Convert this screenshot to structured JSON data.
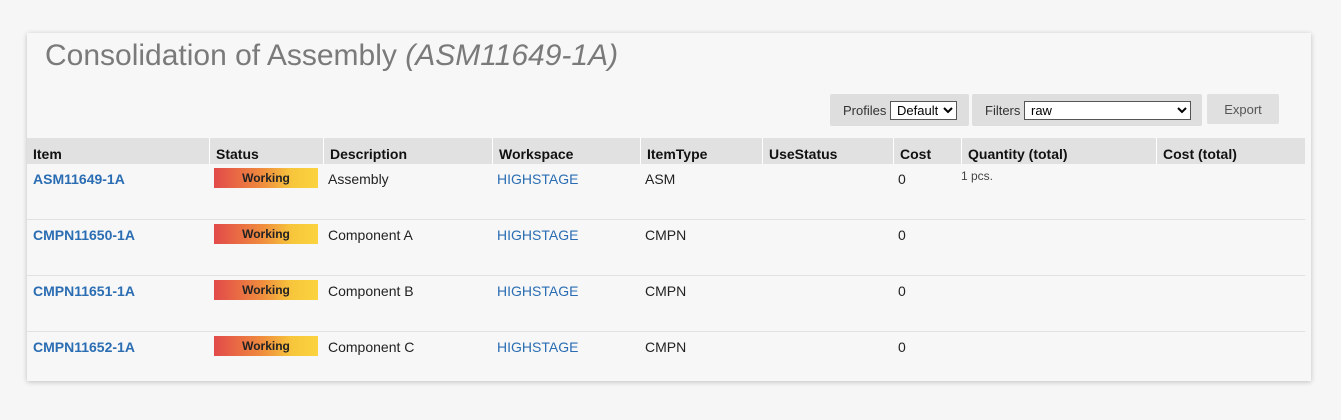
{
  "page": {
    "title_main": "Consolidation of Assembly",
    "title_code": "(ASM11649-1A)"
  },
  "toolbar": {
    "profiles_label": "Profiles",
    "profiles_value": "Default",
    "filters_label": "Filters",
    "filters_value": "raw",
    "export_label": "Export"
  },
  "table": {
    "columns": [
      "Item",
      "Status",
      "Description",
      "Workspace",
      "ItemType",
      "UseStatus",
      "Cost",
      "Quantity (total)",
      "Cost (total)"
    ],
    "rows": [
      {
        "item": "ASM11649-1A",
        "status": "Working",
        "description": "Assembly",
        "workspace": "HIGHSTAGE",
        "itemtype": "ASM",
        "usestatus": "",
        "cost": "0",
        "quantity_total": "1 pcs.",
        "cost_total": ""
      },
      {
        "item": "CMPN11650-1A",
        "status": "Working",
        "description": "Component A",
        "workspace": "HIGHSTAGE",
        "itemtype": "CMPN",
        "usestatus": "",
        "cost": "0",
        "quantity_total": "",
        "cost_total": ""
      },
      {
        "item": "CMPN11651-1A",
        "status": "Working",
        "description": "Component B",
        "workspace": "HIGHSTAGE",
        "itemtype": "CMPN",
        "usestatus": "",
        "cost": "0",
        "quantity_total": "",
        "cost_total": ""
      },
      {
        "item": "CMPN11652-1A",
        "status": "Working",
        "description": "Component C",
        "workspace": "HIGHSTAGE",
        "itemtype": "CMPN",
        "usestatus": "",
        "cost": "0",
        "quantity_total": "",
        "cost_total": ""
      }
    ]
  },
  "colors": {
    "link": "#2a6db3",
    "status_gradient_start": "#e24a4a",
    "status_gradient_end": "#fbd33e",
    "header_bg": "#e1e1e1"
  }
}
